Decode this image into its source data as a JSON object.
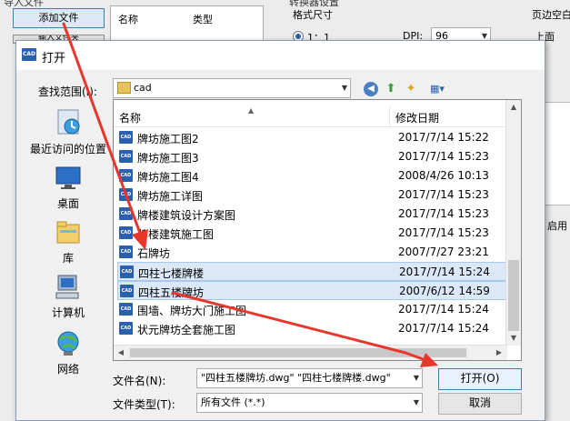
{
  "background": {
    "group_label": "导入文件",
    "add_file_button": "添加文件",
    "partial_button": "输入文件夹",
    "list_headers": [
      "名称",
      "类型"
    ],
    "converter_settings_label": "转换器设置",
    "format_size_label": "格式尺寸",
    "scale_radio": "1：1",
    "dpi_label": "DPI:",
    "dpi_value": "96",
    "margin_label": "页边空白",
    "margin_top_label": "上面",
    "apply_checkbox_label": "启用"
  },
  "dialog": {
    "title": "打开",
    "look_in_label": "查找范围(I):",
    "look_in_value": "cad",
    "places": [
      {
        "label": "最近访问的位置",
        "icon": "recent-places-icon"
      },
      {
        "label": "桌面",
        "icon": "desktop-icon"
      },
      {
        "label": "库",
        "icon": "libraries-icon"
      },
      {
        "label": "计算机",
        "icon": "computer-icon"
      },
      {
        "label": "网络",
        "icon": "network-icon"
      }
    ],
    "columns": {
      "name": "名称",
      "date": "修改日期"
    },
    "files": [
      {
        "name": "牌坊施工图2",
        "date": "2017/7/14 15:22",
        "selected": false
      },
      {
        "name": "牌坊施工图3",
        "date": "2017/7/14 15:23",
        "selected": false
      },
      {
        "name": "牌坊施工图4",
        "date": "2008/4/26 10:13",
        "selected": false
      },
      {
        "name": "牌坊施工详图",
        "date": "2017/7/14 15:23",
        "selected": false
      },
      {
        "name": "牌楼建筑设计方案图",
        "date": "2017/7/14 15:23",
        "selected": false
      },
      {
        "name": "牌楼建筑施工图",
        "date": "2017/7/14 15:23",
        "selected": false
      },
      {
        "name": "石牌坊",
        "date": "2007/7/27 23:21",
        "selected": false
      },
      {
        "name": "四柱七楼牌楼",
        "date": "2017/7/14 15:24",
        "selected": true
      },
      {
        "name": "四柱五楼牌坊",
        "date": "2007/6/12 14:59",
        "selected": true
      },
      {
        "name": "围墙、牌坊大门施工图",
        "date": "2017/7/14 15:24",
        "selected": false
      },
      {
        "name": "状元牌坊全套施工图",
        "date": "2017/7/14 15:24",
        "selected": false
      }
    ],
    "filename_label": "文件名(N):",
    "filename_value": "\"四柱五楼牌坊.dwg\" \"四柱七楼牌楼.dwg\"",
    "filetype_label": "文件类型(T):",
    "filetype_value": "所有文件 (*.*)",
    "open_button": "打开(O)",
    "cancel_button": "取消"
  },
  "colors": {
    "arrow": "#e8362c",
    "selection": "#dbe8f8",
    "cad_icon": "#2b5fb0"
  }
}
